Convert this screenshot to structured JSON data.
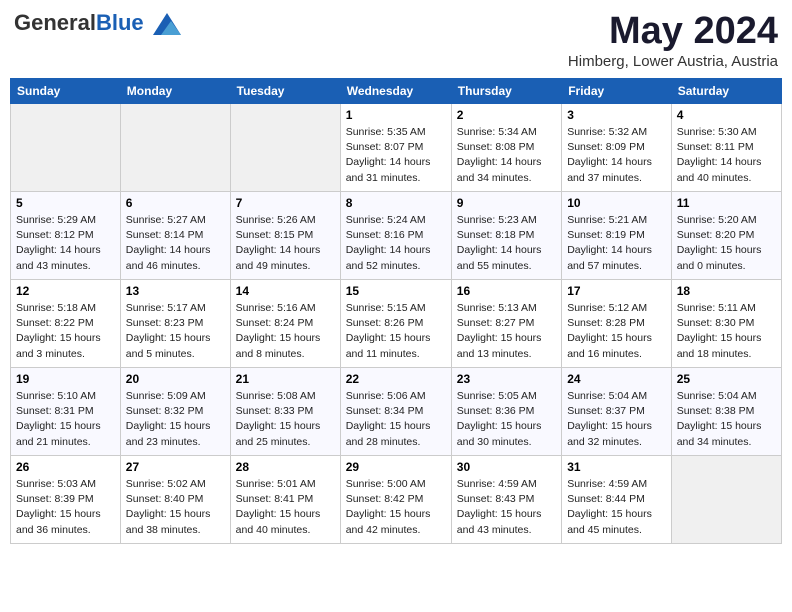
{
  "header": {
    "logo_general": "General",
    "logo_blue": "Blue",
    "month_title": "May 2024",
    "location": "Himberg, Lower Austria, Austria"
  },
  "weekdays": [
    "Sunday",
    "Monday",
    "Tuesday",
    "Wednesday",
    "Thursday",
    "Friday",
    "Saturday"
  ],
  "weeks": [
    [
      {
        "day": "",
        "sunrise": "",
        "sunset": "",
        "daylight": ""
      },
      {
        "day": "",
        "sunrise": "",
        "sunset": "",
        "daylight": ""
      },
      {
        "day": "",
        "sunrise": "",
        "sunset": "",
        "daylight": ""
      },
      {
        "day": "1",
        "sunrise": "Sunrise: 5:35 AM",
        "sunset": "Sunset: 8:07 PM",
        "daylight": "Daylight: 14 hours and 31 minutes."
      },
      {
        "day": "2",
        "sunrise": "Sunrise: 5:34 AM",
        "sunset": "Sunset: 8:08 PM",
        "daylight": "Daylight: 14 hours and 34 minutes."
      },
      {
        "day": "3",
        "sunrise": "Sunrise: 5:32 AM",
        "sunset": "Sunset: 8:09 PM",
        "daylight": "Daylight: 14 hours and 37 minutes."
      },
      {
        "day": "4",
        "sunrise": "Sunrise: 5:30 AM",
        "sunset": "Sunset: 8:11 PM",
        "daylight": "Daylight: 14 hours and 40 minutes."
      }
    ],
    [
      {
        "day": "5",
        "sunrise": "Sunrise: 5:29 AM",
        "sunset": "Sunset: 8:12 PM",
        "daylight": "Daylight: 14 hours and 43 minutes."
      },
      {
        "day": "6",
        "sunrise": "Sunrise: 5:27 AM",
        "sunset": "Sunset: 8:14 PM",
        "daylight": "Daylight: 14 hours and 46 minutes."
      },
      {
        "day": "7",
        "sunrise": "Sunrise: 5:26 AM",
        "sunset": "Sunset: 8:15 PM",
        "daylight": "Daylight: 14 hours and 49 minutes."
      },
      {
        "day": "8",
        "sunrise": "Sunrise: 5:24 AM",
        "sunset": "Sunset: 8:16 PM",
        "daylight": "Daylight: 14 hours and 52 minutes."
      },
      {
        "day": "9",
        "sunrise": "Sunrise: 5:23 AM",
        "sunset": "Sunset: 8:18 PM",
        "daylight": "Daylight: 14 hours and 55 minutes."
      },
      {
        "day": "10",
        "sunrise": "Sunrise: 5:21 AM",
        "sunset": "Sunset: 8:19 PM",
        "daylight": "Daylight: 14 hours and 57 minutes."
      },
      {
        "day": "11",
        "sunrise": "Sunrise: 5:20 AM",
        "sunset": "Sunset: 8:20 PM",
        "daylight": "Daylight: 15 hours and 0 minutes."
      }
    ],
    [
      {
        "day": "12",
        "sunrise": "Sunrise: 5:18 AM",
        "sunset": "Sunset: 8:22 PM",
        "daylight": "Daylight: 15 hours and 3 minutes."
      },
      {
        "day": "13",
        "sunrise": "Sunrise: 5:17 AM",
        "sunset": "Sunset: 8:23 PM",
        "daylight": "Daylight: 15 hours and 5 minutes."
      },
      {
        "day": "14",
        "sunrise": "Sunrise: 5:16 AM",
        "sunset": "Sunset: 8:24 PM",
        "daylight": "Daylight: 15 hours and 8 minutes."
      },
      {
        "day": "15",
        "sunrise": "Sunrise: 5:15 AM",
        "sunset": "Sunset: 8:26 PM",
        "daylight": "Daylight: 15 hours and 11 minutes."
      },
      {
        "day": "16",
        "sunrise": "Sunrise: 5:13 AM",
        "sunset": "Sunset: 8:27 PM",
        "daylight": "Daylight: 15 hours and 13 minutes."
      },
      {
        "day": "17",
        "sunrise": "Sunrise: 5:12 AM",
        "sunset": "Sunset: 8:28 PM",
        "daylight": "Daylight: 15 hours and 16 minutes."
      },
      {
        "day": "18",
        "sunrise": "Sunrise: 5:11 AM",
        "sunset": "Sunset: 8:30 PM",
        "daylight": "Daylight: 15 hours and 18 minutes."
      }
    ],
    [
      {
        "day": "19",
        "sunrise": "Sunrise: 5:10 AM",
        "sunset": "Sunset: 8:31 PM",
        "daylight": "Daylight: 15 hours and 21 minutes."
      },
      {
        "day": "20",
        "sunrise": "Sunrise: 5:09 AM",
        "sunset": "Sunset: 8:32 PM",
        "daylight": "Daylight: 15 hours and 23 minutes."
      },
      {
        "day": "21",
        "sunrise": "Sunrise: 5:08 AM",
        "sunset": "Sunset: 8:33 PM",
        "daylight": "Daylight: 15 hours and 25 minutes."
      },
      {
        "day": "22",
        "sunrise": "Sunrise: 5:06 AM",
        "sunset": "Sunset: 8:34 PM",
        "daylight": "Daylight: 15 hours and 28 minutes."
      },
      {
        "day": "23",
        "sunrise": "Sunrise: 5:05 AM",
        "sunset": "Sunset: 8:36 PM",
        "daylight": "Daylight: 15 hours and 30 minutes."
      },
      {
        "day": "24",
        "sunrise": "Sunrise: 5:04 AM",
        "sunset": "Sunset: 8:37 PM",
        "daylight": "Daylight: 15 hours and 32 minutes."
      },
      {
        "day": "25",
        "sunrise": "Sunrise: 5:04 AM",
        "sunset": "Sunset: 8:38 PM",
        "daylight": "Daylight: 15 hours and 34 minutes."
      }
    ],
    [
      {
        "day": "26",
        "sunrise": "Sunrise: 5:03 AM",
        "sunset": "Sunset: 8:39 PM",
        "daylight": "Daylight: 15 hours and 36 minutes."
      },
      {
        "day": "27",
        "sunrise": "Sunrise: 5:02 AM",
        "sunset": "Sunset: 8:40 PM",
        "daylight": "Daylight: 15 hours and 38 minutes."
      },
      {
        "day": "28",
        "sunrise": "Sunrise: 5:01 AM",
        "sunset": "Sunset: 8:41 PM",
        "daylight": "Daylight: 15 hours and 40 minutes."
      },
      {
        "day": "29",
        "sunrise": "Sunrise: 5:00 AM",
        "sunset": "Sunset: 8:42 PM",
        "daylight": "Daylight: 15 hours and 42 minutes."
      },
      {
        "day": "30",
        "sunrise": "Sunrise: 4:59 AM",
        "sunset": "Sunset: 8:43 PM",
        "daylight": "Daylight: 15 hours and 43 minutes."
      },
      {
        "day": "31",
        "sunrise": "Sunrise: 4:59 AM",
        "sunset": "Sunset: 8:44 PM",
        "daylight": "Daylight: 15 hours and 45 minutes."
      },
      {
        "day": "",
        "sunrise": "",
        "sunset": "",
        "daylight": ""
      }
    ]
  ]
}
